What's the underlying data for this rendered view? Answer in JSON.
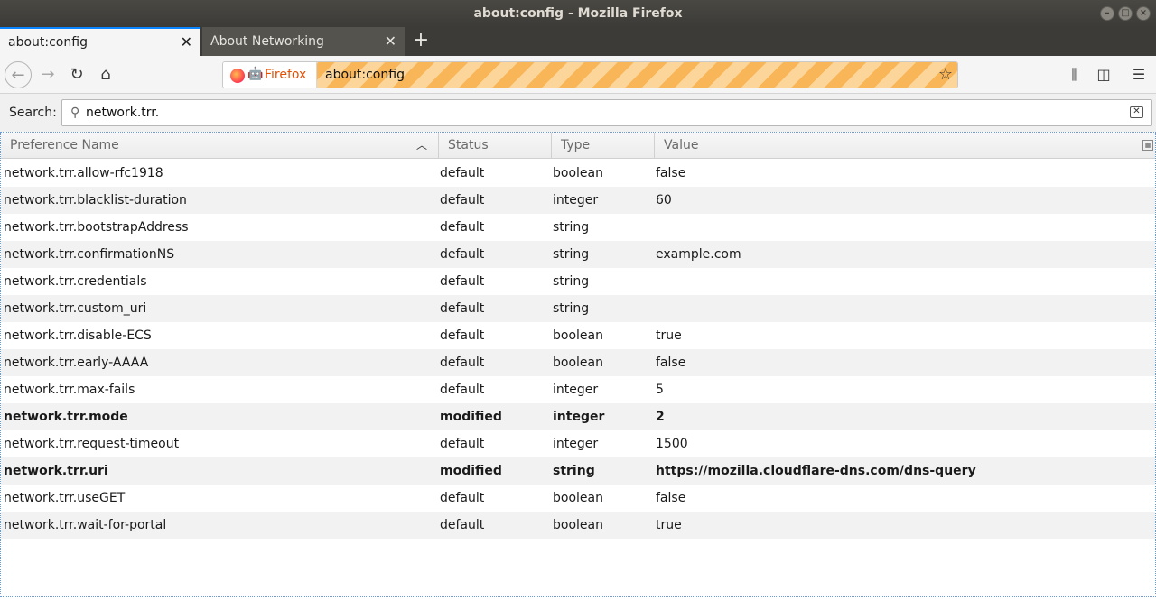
{
  "window": {
    "title": "about:config - Mozilla Firefox"
  },
  "tabs": [
    {
      "label": "about:config",
      "active": true
    },
    {
      "label": "About Networking",
      "active": false
    }
  ],
  "toolbar": {
    "identity_label": "Firefox",
    "url": "about:config"
  },
  "search": {
    "label": "Search:",
    "value": "network.trr."
  },
  "table": {
    "columns": [
      "Preference Name",
      "Status",
      "Type",
      "Value"
    ],
    "sort_column": "Preference Name",
    "rows": [
      {
        "name": "network.trr.allow-rfc1918",
        "status": "default",
        "type": "boolean",
        "value": "false",
        "modified": false
      },
      {
        "name": "network.trr.blacklist-duration",
        "status": "default",
        "type": "integer",
        "value": "60",
        "modified": false
      },
      {
        "name": "network.trr.bootstrapAddress",
        "status": "default",
        "type": "string",
        "value": "",
        "modified": false
      },
      {
        "name": "network.trr.confirmationNS",
        "status": "default",
        "type": "string",
        "value": "example.com",
        "modified": false
      },
      {
        "name": "network.trr.credentials",
        "status": "default",
        "type": "string",
        "value": "",
        "modified": false
      },
      {
        "name": "network.trr.custom_uri",
        "status": "default",
        "type": "string",
        "value": "",
        "modified": false
      },
      {
        "name": "network.trr.disable-ECS",
        "status": "default",
        "type": "boolean",
        "value": "true",
        "modified": false
      },
      {
        "name": "network.trr.early-AAAA",
        "status": "default",
        "type": "boolean",
        "value": "false",
        "modified": false
      },
      {
        "name": "network.trr.max-fails",
        "status": "default",
        "type": "integer",
        "value": "5",
        "modified": false
      },
      {
        "name": "network.trr.mode",
        "status": "modified",
        "type": "integer",
        "value": "2",
        "modified": true
      },
      {
        "name": "network.trr.request-timeout",
        "status": "default",
        "type": "integer",
        "value": "1500",
        "modified": false
      },
      {
        "name": "network.trr.uri",
        "status": "modified",
        "type": "string",
        "value": "https://mozilla.cloudflare-dns.com/dns-query",
        "modified": true
      },
      {
        "name": "network.trr.useGET",
        "status": "default",
        "type": "boolean",
        "value": "false",
        "modified": false
      },
      {
        "name": "network.trr.wait-for-portal",
        "status": "default",
        "type": "boolean",
        "value": "true",
        "modified": false
      }
    ]
  },
  "icons": {
    "back": "back-arrow-icon",
    "forward": "forward-arrow-icon",
    "reload": "reload-icon",
    "home": "home-icon",
    "bookmark": "star-icon",
    "library": "library-icon",
    "sidebar": "sidebar-icon",
    "menu": "hamburger-menu-icon"
  },
  "colors": {
    "tab_accent": "#0a84ff",
    "identity_text": "#e45000"
  }
}
